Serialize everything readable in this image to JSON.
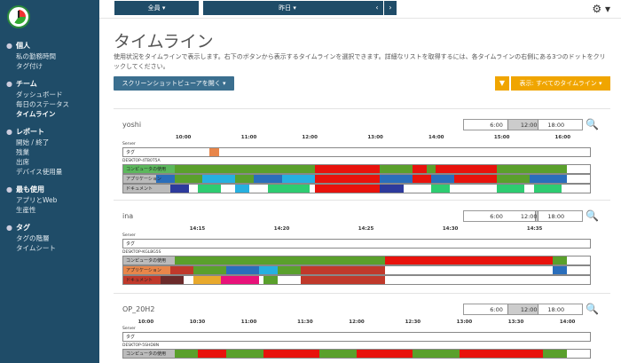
{
  "sidebar": {
    "sections": [
      {
        "label": "個人",
        "icon": "person-icon",
        "items": [
          "私の勤務時間",
          "タグ付け"
        ]
      },
      {
        "label": "チーム",
        "icon": "team-icon",
        "items": [
          "ダッシュボード",
          "毎日のステータス",
          "タイムライン"
        ]
      },
      {
        "label": "レポート",
        "icon": "report-icon",
        "items": [
          "開始 / 終了",
          "残業",
          "出席",
          "デバイス使用量"
        ]
      },
      {
        "label": "最も使用",
        "icon": "usage-icon",
        "items": [
          "アプリとWeb",
          "生産性"
        ]
      },
      {
        "label": "タグ",
        "icon": "tag-icon",
        "items": [
          "タグの階層",
          "タイムシート"
        ]
      }
    ],
    "active_item": "タイムライン"
  },
  "topbar": {
    "member_filter": "全員 ▾",
    "date_filter": "昨日 ▾",
    "prev": "‹",
    "next": "›",
    "settings": "⚙ ▾"
  },
  "page": {
    "title": "タイムライン",
    "description": "使用状況をタイムラインで表示します。右下のボタンから表示するタイムラインを選択できます。詳細なリストを取得するには、各タイムラインの右側にある3つのドットをクリックしてください。",
    "open_viewer_button": "スクリーンショットビューアを開く ▾",
    "show_button": "表示: すべてのタイムライン ▾"
  },
  "timelines": [
    {
      "user": "yoshi",
      "device": "DESKTOP-4TB0T5A",
      "slider": {
        "labels": [
          "6:00",
          "12:00",
          "18:00"
        ],
        "sel_start": 0.37,
        "sel_end": 0.63
      },
      "ticks": [
        "10:00",
        "11:00",
        "12:00",
        "13:00",
        "14:00",
        "15:00",
        "16:00"
      ],
      "tick_pos": [
        0.13,
        0.27,
        0.4,
        0.54,
        0.67,
        0.81,
        0.94
      ],
      "lanes": [
        "タグ",
        "コンピュータの使用",
        "アプリケーション",
        "ドキュメント"
      ],
      "tag_segments": [
        [
          0.185,
          0.205,
          "#e8864a"
        ]
      ],
      "usage_segments": [
        [
          0.0,
          0.11,
          "#5cb85c"
        ],
        [
          0.11,
          0.18,
          "#5aa02c"
        ],
        [
          0.18,
          0.24,
          "#5aa02c"
        ],
        [
          0.24,
          0.41,
          "#5aa02c"
        ],
        [
          0.41,
          0.55,
          "#e8120c"
        ],
        [
          0.55,
          0.62,
          "#5aa02c"
        ],
        [
          0.62,
          0.65,
          "#e8120c"
        ],
        [
          0.65,
          0.67,
          "#5aa02c"
        ],
        [
          0.67,
          0.8,
          "#e8120c"
        ],
        [
          0.8,
          0.95,
          "#5aa02c"
        ]
      ],
      "app_segments": [
        [
          0.0,
          0.07,
          "#bbbbbb"
        ],
        [
          0.07,
          0.11,
          "#2a6ebb"
        ],
        [
          0.11,
          0.17,
          "#5aa02c"
        ],
        [
          0.17,
          0.24,
          "#26b0e0"
        ],
        [
          0.24,
          0.28,
          "#5aa02c"
        ],
        [
          0.28,
          0.34,
          "#2a6ebb"
        ],
        [
          0.34,
          0.41,
          "#26b0e0"
        ],
        [
          0.41,
          0.55,
          "#e8120c"
        ],
        [
          0.55,
          0.62,
          "#2a6ebb"
        ],
        [
          0.62,
          0.66,
          "#e8120c"
        ],
        [
          0.66,
          0.71,
          "#2a6ebb"
        ],
        [
          0.71,
          0.8,
          "#e8120c"
        ],
        [
          0.8,
          0.87,
          "#5aa02c"
        ],
        [
          0.87,
          0.95,
          "#2a6ebb"
        ]
      ],
      "doc_segments": [
        [
          0.0,
          0.1,
          "#bbbbbb"
        ],
        [
          0.1,
          0.14,
          "#2d3a9c"
        ],
        [
          0.16,
          0.21,
          "#2ecc71"
        ],
        [
          0.24,
          0.27,
          "#26b0e0"
        ],
        [
          0.31,
          0.4,
          "#2ecc71"
        ],
        [
          0.41,
          0.55,
          "#e8120c"
        ],
        [
          0.55,
          0.6,
          "#2d3a9c"
        ],
        [
          0.66,
          0.7,
          "#2ecc71"
        ],
        [
          0.8,
          0.86,
          "#2ecc71"
        ],
        [
          0.88,
          0.94,
          "#2ecc71"
        ]
      ]
    },
    {
      "user": "ina",
      "device": "DESKTOP-KGLBG5S",
      "slider": {
        "labels": [
          "6:00",
          "12:00",
          "18:00"
        ],
        "sel_start": 0.6,
        "sel_end": 0.63
      },
      "ticks": [
        "14:15",
        "14:20",
        "14:25",
        "14:30",
        "14:35"
      ],
      "tick_pos": [
        0.16,
        0.34,
        0.52,
        0.7,
        0.88
      ],
      "lanes": [
        "タグ",
        "コンピュータの使用",
        "アプリケーション",
        "ドキュメント"
      ],
      "tag_segments": [],
      "usage_segments": [
        [
          0.0,
          0.11,
          "#bbbbbb"
        ],
        [
          0.11,
          0.56,
          "#5aa02c"
        ],
        [
          0.56,
          0.92,
          "#e8120c"
        ],
        [
          0.92,
          0.95,
          "#5aa02c"
        ]
      ],
      "app_segments": [
        [
          0.0,
          0.1,
          "#e8864a"
        ],
        [
          0.1,
          0.15,
          "#c0392b"
        ],
        [
          0.15,
          0.22,
          "#5aa02c"
        ],
        [
          0.22,
          0.29,
          "#2a6ebb"
        ],
        [
          0.29,
          0.33,
          "#26b0e0"
        ],
        [
          0.33,
          0.38,
          "#5aa02c"
        ],
        [
          0.38,
          0.56,
          "#c0392b"
        ],
        [
          0.92,
          0.95,
          "#2a6ebb"
        ]
      ],
      "doc_segments": [
        [
          0.0,
          0.08,
          "#c0392b"
        ],
        [
          0.08,
          0.13,
          "#6b2a2a"
        ],
        [
          0.15,
          0.21,
          "#e8a92c"
        ],
        [
          0.21,
          0.29,
          "#e8127a"
        ],
        [
          0.3,
          0.33,
          "#5aa02c"
        ],
        [
          0.38,
          0.56,
          "#c0392b"
        ]
      ]
    },
    {
      "user": "OP_20H2",
      "device": "DESKTOP-5SHD8N",
      "slider": {
        "labels": [
          "6:00",
          "12:00",
          "18:00"
        ],
        "sel_start": 0.37,
        "sel_end": 0.63
      },
      "ticks": [
        "10:00",
        "10:30",
        "11:00",
        "11:30",
        "12:00",
        "12:30",
        "13:00",
        "13:30",
        "14:00"
      ],
      "tick_pos": [
        0.05,
        0.16,
        0.27,
        0.39,
        0.5,
        0.62,
        0.73,
        0.84,
        0.95
      ],
      "lanes": [
        "タグ",
        "コンピュータの使用"
      ],
      "tag_segments": [],
      "usage_segments": [
        [
          0.0,
          0.11,
          "#bbbbbb"
        ],
        [
          0.11,
          0.16,
          "#5aa02c"
        ],
        [
          0.16,
          0.22,
          "#e8120c"
        ],
        [
          0.22,
          0.3,
          "#5aa02c"
        ],
        [
          0.3,
          0.42,
          "#e8120c"
        ],
        [
          0.42,
          0.5,
          "#5aa02c"
        ],
        [
          0.5,
          0.62,
          "#e8120c"
        ],
        [
          0.62,
          0.72,
          "#5aa02c"
        ],
        [
          0.72,
          0.9,
          "#e8120c"
        ],
        [
          0.9,
          0.95,
          "#5aa02c"
        ]
      ],
      "app_segments": [],
      "doc_segments": []
    }
  ],
  "colors": {
    "sidebar": "#1f4c68",
    "accent": "#f0a500",
    "primary_button": "#3b6f8f"
  }
}
